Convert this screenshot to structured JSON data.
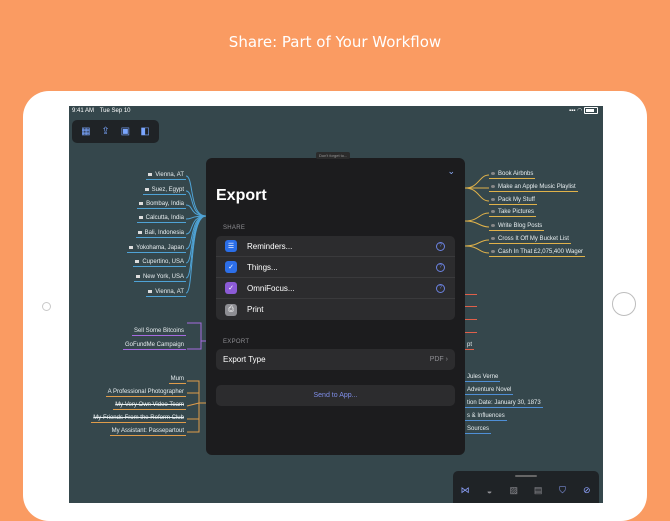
{
  "headline": "Share: Part of Your Workflow",
  "status_bar": {
    "time": "9:41 AM",
    "date": "Tue Sep 10"
  },
  "tooltip": "Don't forget to...",
  "map": {
    "left_nodes": [
      "Vienna, AT",
      "Suez, Egypt",
      "Bombay, India",
      "Calcutta, India",
      "Bali, Indonesia",
      "Yokohama, Japan",
      "Cupertino, USA",
      "New York, USA",
      "Vienna, AT"
    ],
    "left_purple": [
      "Sell Some Bitcoins",
      "GoFundMe Campaign"
    ],
    "left_orange": [
      "Mum",
      "A Professional Photographer",
      "My Very Own Video Team",
      "My Friends From the Reform Club",
      "My Assistant: Passepartout"
    ],
    "right_nodes": [
      "Book Airbnbs",
      "Make an Apple Music Playlist",
      "Pack My Stuff",
      "Take Pictures",
      "Write Blog Posts",
      "Cross It Off My Bucket List",
      "Cash In That £2,075,400 Wager"
    ],
    "right_fragments": [
      "s",
      "g"
    ],
    "right_red": [
      "pt"
    ],
    "right_bottom": [
      "Jules Verne",
      "Adventure Novel",
      "tion Date: January 30, 1873",
      "s & Influences",
      "Sources"
    ]
  },
  "export_sheet": {
    "title": "Export",
    "share_header": "SHARE",
    "share_items": [
      {
        "label": "Reminders...",
        "color": "#2a6ee8",
        "glyph": "☰"
      },
      {
        "label": "Things...",
        "color": "#2d6fe8",
        "glyph": "✓"
      },
      {
        "label": "OmniFocus...",
        "color": "#8c5bd6",
        "glyph": "✓"
      },
      {
        "label": "Print",
        "color": "#8e8e93",
        "glyph": "⎙"
      }
    ],
    "help_glyph": "?",
    "export_header": "EXPORT",
    "export_type_label": "Export Type",
    "export_type_value": "PDF",
    "send_button": "Send to App..."
  }
}
